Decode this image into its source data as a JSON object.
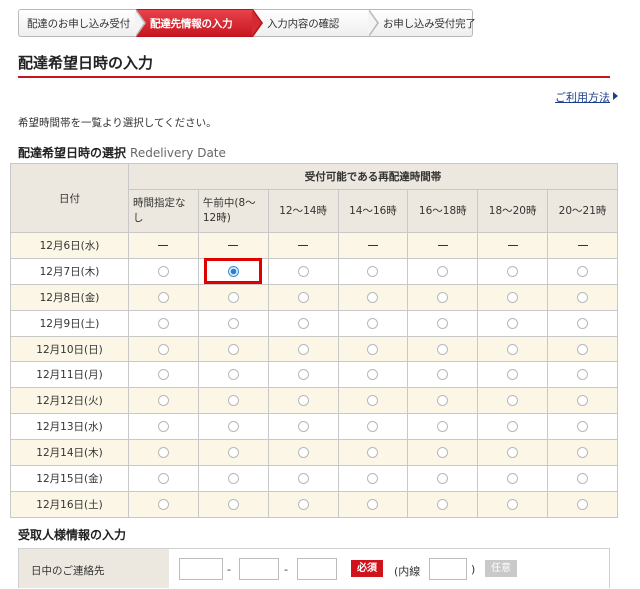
{
  "steps": [
    {
      "label": "配達のお申し込み受付",
      "active": false
    },
    {
      "label": "配達先情報の入力",
      "active": true
    },
    {
      "label": "入力内容の確認",
      "active": false
    },
    {
      "label": "お申し込み受付完了",
      "active": false
    }
  ],
  "page_title": "配達希望日時の入力",
  "help_link": "ご利用方法",
  "instruction": "希望時間帯を一覧より選択してください。",
  "section": {
    "title": "配達希望日時の選択",
    "subtitle": "Redelivery Date"
  },
  "table": {
    "date_header": "日付",
    "group_header": "受付可能である再配達時間帯",
    "slots": [
      "時間指定なし",
      "午前中(8〜12時)",
      "12〜14時",
      "14〜16時",
      "16〜18時",
      "18〜20時",
      "20〜21時"
    ],
    "rows": [
      {
        "date": "12月6日(水)",
        "available": false
      },
      {
        "date": "12月7日(木)",
        "available": true,
        "selected_slot": 1
      },
      {
        "date": "12月8日(金)",
        "available": true
      },
      {
        "date": "12月9日(土)",
        "available": true
      },
      {
        "date": "12月10日(日)",
        "available": true
      },
      {
        "date": "12月11日(月)",
        "available": true
      },
      {
        "date": "12月12日(火)",
        "available": true
      },
      {
        "date": "12月13日(水)",
        "available": true
      },
      {
        "date": "12月14日(木)",
        "available": true
      },
      {
        "date": "12月15日(金)",
        "available": true
      },
      {
        "date": "12月16日(土)",
        "available": true
      }
    ]
  },
  "recipient": {
    "title": "受取人様情報の入力",
    "phone_label": "日中のご連絡先",
    "separator": "-",
    "required_badge": "必須",
    "extension_open": "(内線",
    "extension_close": ")",
    "optional_badge": "任意"
  },
  "colors": {
    "accent": "#c8161e",
    "header_bg": "#ede8df",
    "odd_row_bg": "#fbf6e6",
    "link": "#1a3e8c",
    "highlight": "#e00000"
  }
}
